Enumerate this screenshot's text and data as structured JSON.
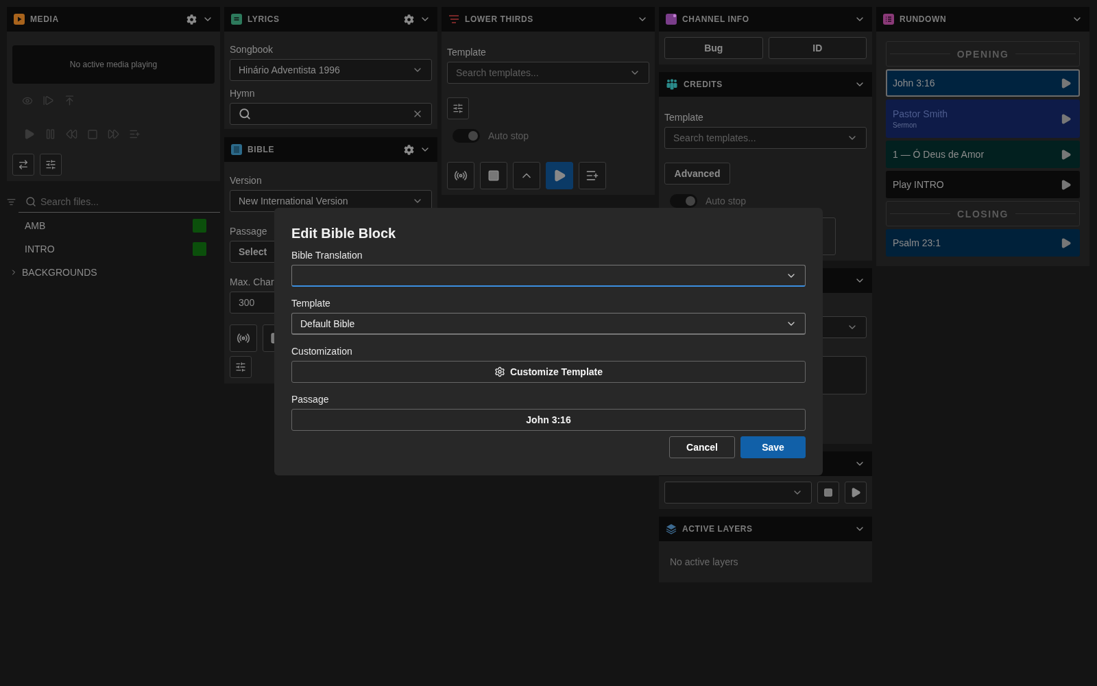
{
  "media": {
    "title": "MEDIA",
    "status": "No active media playing",
    "search": {
      "placeholder": "Search files..."
    },
    "files": [
      {
        "kind": "file",
        "name": "AMB",
        "color": "#0b4f0b"
      },
      {
        "kind": "file",
        "name": "INTRO",
        "color": "#0b4f0b"
      },
      {
        "kind": "folder",
        "name": "BACKGROUNDS",
        "expanded": false
      }
    ]
  },
  "lyrics": {
    "title": "LYRICS",
    "songbook_label": "Songbook",
    "songbook": "Hinário Adventista 1996",
    "hymn_label": "Hymn"
  },
  "bible": {
    "title": "BIBLE",
    "version_label": "Version",
    "version": "New International Version",
    "passage_label": "Passage",
    "passage_button": "Select",
    "max_label": "Max. Char",
    "max_value": "300"
  },
  "lower_thirds": {
    "title": "LOWER THIRDS",
    "template_label": "Template",
    "template": {
      "placeholder": "Search templates..."
    },
    "auto_stop": {
      "label": "Auto stop",
      "on": true
    }
  },
  "channel_info": {
    "title": "CHANNEL INFO",
    "buttons": [
      "Bug",
      "ID"
    ]
  },
  "credits": {
    "title": "CREDITS",
    "template_label": "Template",
    "template": {
      "placeholder": "Search templates..."
    },
    "advanced": "Advanced",
    "auto_stop": {
      "label": "Auto stop",
      "on": true
    }
  },
  "active_layers": {
    "title": "ACTIVE LAYERS",
    "empty": "No active layers"
  },
  "rundown": {
    "title": "RUNDOWN",
    "items": [
      {
        "kind": "section",
        "label": "OPENING"
      },
      {
        "kind": "item",
        "label": "John 3:16",
        "color": "#00233f",
        "selected": true
      },
      {
        "kind": "item",
        "label": "Pastor Smith",
        "sublabel": "Sermon",
        "color": "#0e1b48",
        "selected": false
      },
      {
        "kind": "item",
        "label": "1 — Ó Deus de Amor",
        "color": "#02201f",
        "selected": false
      },
      {
        "kind": "item",
        "label": "Play INTRO",
        "color": "#0a0a0a",
        "selected": false
      },
      {
        "kind": "section",
        "label": "CLOSING"
      },
      {
        "kind": "item",
        "label": "Psalm 23:1",
        "color": "#00213a",
        "selected": false
      }
    ]
  },
  "dialog": {
    "title": "Edit Bible Block",
    "fields": [
      {
        "kind": "select",
        "label": "Bible Translation",
        "focused": true
      },
      {
        "kind": "select",
        "label": "Template",
        "value": "Default Bible",
        "focused": false
      },
      {
        "kind": "settings_button",
        "label": "Customization",
        "button": "Customize Template"
      },
      {
        "kind": "button",
        "label": "Passage",
        "button": "John 3:16"
      }
    ],
    "buttons": [
      {
        "label": "Cancel",
        "primary": false
      },
      {
        "label": "Save",
        "primary": true
      }
    ]
  }
}
